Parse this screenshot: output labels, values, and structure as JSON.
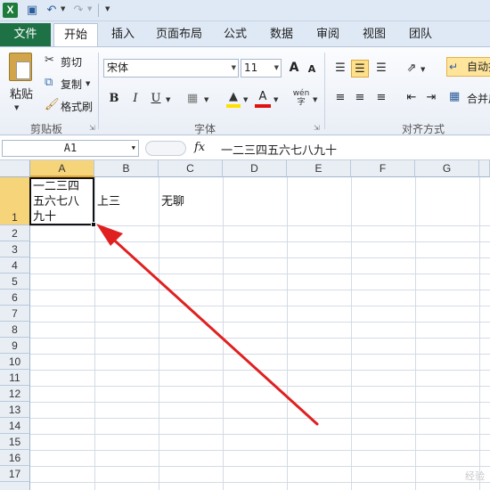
{
  "qat": {
    "app_icon": "X",
    "save_icon": "floppy-icon",
    "undo_icon": "undo-icon",
    "redo_icon": "redo-icon"
  },
  "tabs": {
    "file": "文件",
    "items": [
      "开始",
      "插入",
      "页面布局",
      "公式",
      "数据",
      "审阅",
      "视图",
      "团队"
    ]
  },
  "ribbon": {
    "clipboard": {
      "paste": "粘贴",
      "cut": "剪切",
      "copy": "复制",
      "format_painter": "格式刷",
      "label": "剪贴板"
    },
    "font": {
      "name": "宋体",
      "size": "11",
      "grow": "A",
      "shrink": "A",
      "bold": "B",
      "italic": "I",
      "underline": "U",
      "font_color_glyph": "A",
      "label": "字体"
    },
    "alignment": {
      "wrap_text": "自动换",
      "merge": "合并后",
      "label": "对齐方式"
    }
  },
  "formula_bar": {
    "name_box": "A1",
    "fx": "fx",
    "value": "一二三四五六七八九十"
  },
  "grid": {
    "columns": [
      "A",
      "B",
      "C",
      "D",
      "E",
      "F",
      "G"
    ],
    "rows": [
      "1",
      "2",
      "3",
      "4",
      "5",
      "6",
      "7",
      "8",
      "9",
      "10",
      "11",
      "12",
      "13",
      "14",
      "15",
      "16",
      "17"
    ],
    "cells": {
      "A1_line1": "一二三四",
      "A1_line2": "五六七八",
      "A1_line3": "九十",
      "B1": "上三",
      "C1": "无聊"
    }
  },
  "annotation": {
    "arrow_color": "#e02020"
  },
  "watermark": "经验"
}
